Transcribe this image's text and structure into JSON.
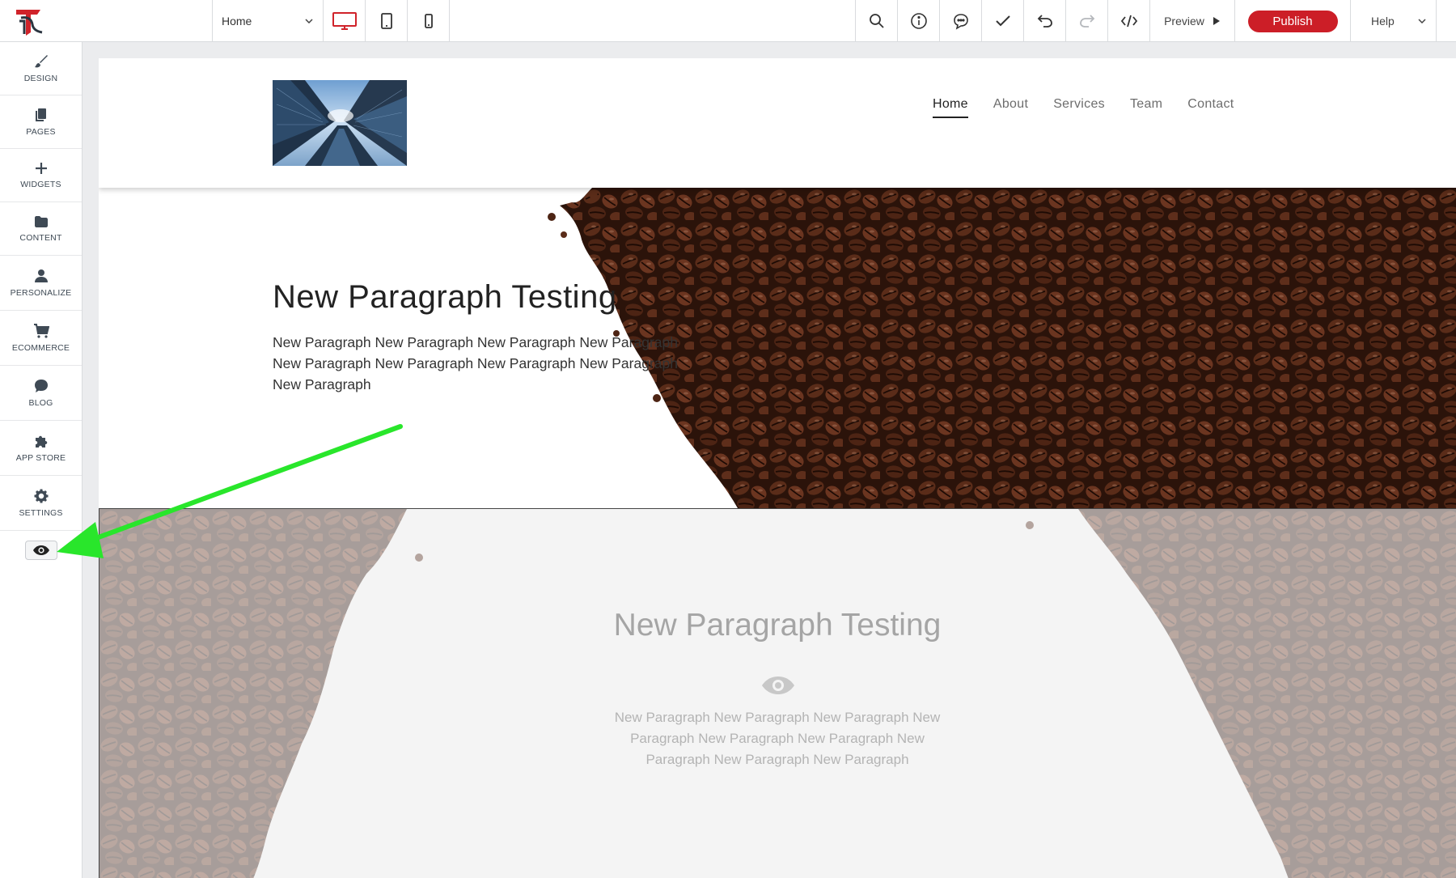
{
  "topbar": {
    "page_selector": "Home",
    "preview_label": "Preview",
    "publish_label": "Publish",
    "help_label": "Help",
    "accent_color": "#cc1e27"
  },
  "sidebar": {
    "items": [
      {
        "label": "DESIGN",
        "icon": "brush-icon"
      },
      {
        "label": "PAGES",
        "icon": "pages-icon"
      },
      {
        "label": "WIDGETS",
        "icon": "plus-icon"
      },
      {
        "label": "CONTENT",
        "icon": "folder-icon"
      },
      {
        "label": "PERSONALIZE",
        "icon": "person-icon"
      },
      {
        "label": "ECOMMERCE",
        "icon": "cart-icon"
      },
      {
        "label": "BLOG",
        "icon": "chat-icon"
      },
      {
        "label": "APP STORE",
        "icon": "puzzle-icon"
      },
      {
        "label": "SETTINGS",
        "icon": "gear-icon"
      }
    ]
  },
  "site": {
    "nav": [
      "Home",
      "About",
      "Services",
      "Team",
      "Contact"
    ],
    "hero": {
      "title": "New Paragraph Testing",
      "text": "New Paragraph New Paragraph New Paragraph New Paragraph New Paragraph New Paragraph New Paragraph New Paragraph New Paragraph"
    },
    "section2": {
      "title": "New Paragraph Testing",
      "text": "New Paragraph New Paragraph New Paragraph New Paragraph New Paragraph New Paragraph New Paragraph New Paragraph New Paragraph"
    }
  }
}
